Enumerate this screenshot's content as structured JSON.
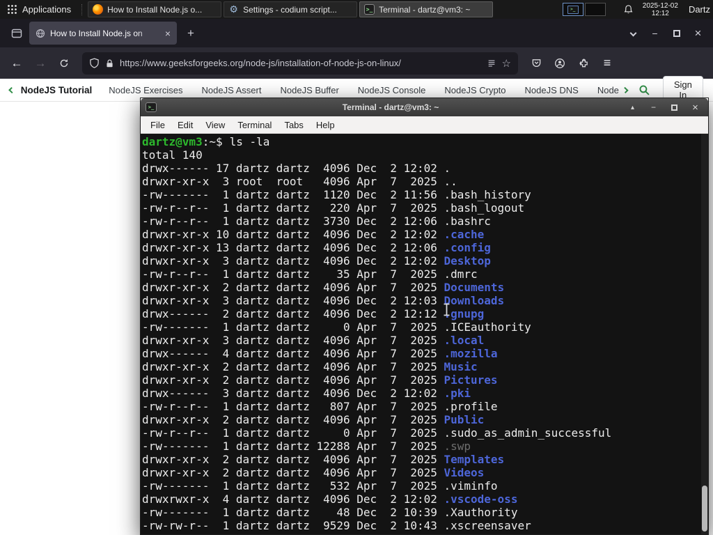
{
  "colors": {
    "gfg_green": "#2f8d46",
    "term_green": "#2db82d",
    "term_blue": "#4d66d9",
    "term_dim": "#6e6e6e"
  },
  "panel": {
    "applications": "Applications",
    "tasks": [
      {
        "label": "How to Install Node.js o...",
        "icon": "firefox"
      },
      {
        "label": "Settings - codium script...",
        "icon": "settings-gear"
      },
      {
        "label": "Terminal - dartz@vm3: ~",
        "icon": "terminal"
      }
    ],
    "date": "2025-12-02",
    "time": "12:12",
    "user": "Dartz"
  },
  "browser": {
    "active_tab": "How to Install Node.js on",
    "url": "https://www.geeksforgeeks.org/node-js/installation-of-node-js-on-linux/"
  },
  "site": {
    "primary": "NodeJS Tutorial",
    "links": [
      "NodeJS Exercises",
      "NodeJS Assert",
      "NodeJS Buffer",
      "NodeJS Console",
      "NodeJS Crypto",
      "NodeJS DNS",
      "Node"
    ],
    "sign_in": "Sign In"
  },
  "terminal": {
    "title": "Terminal - dartz@vm3: ~",
    "menus": [
      "File",
      "Edit",
      "View",
      "Terminal",
      "Tabs",
      "Help"
    ],
    "prompt_user_host": "dartz@vm3",
    "prompt_suffix": ":~$",
    "command": "ls -la",
    "total": "total 140",
    "rows": [
      {
        "perms": "drwx------",
        "links": 17,
        "owner": "dartz",
        "group": "dartz",
        "size": 4096,
        "month": "Dec",
        "day": 2,
        "when": "12:02",
        "name": ".",
        "type": "file"
      },
      {
        "perms": "drwxr-xr-x",
        "links": 3,
        "owner": "root",
        "group": "root",
        "size": 4096,
        "month": "Apr",
        "day": 7,
        "when": "2025",
        "name": "..",
        "type": "file"
      },
      {
        "perms": "-rw-------",
        "links": 1,
        "owner": "dartz",
        "group": "dartz",
        "size": 1120,
        "month": "Dec",
        "day": 2,
        "when": "11:56",
        "name": ".bash_history",
        "type": "file"
      },
      {
        "perms": "-rw-r--r--",
        "links": 1,
        "owner": "dartz",
        "group": "dartz",
        "size": 220,
        "month": "Apr",
        "day": 7,
        "when": "2025",
        "name": ".bash_logout",
        "type": "file"
      },
      {
        "perms": "-rw-r--r--",
        "links": 1,
        "owner": "dartz",
        "group": "dartz",
        "size": 3730,
        "month": "Dec",
        "day": 2,
        "when": "12:06",
        "name": ".bashrc",
        "type": "file"
      },
      {
        "perms": "drwxr-xr-x",
        "links": 10,
        "owner": "dartz",
        "group": "dartz",
        "size": 4096,
        "month": "Dec",
        "day": 2,
        "when": "12:02",
        "name": ".cache",
        "type": "dir"
      },
      {
        "perms": "drwxr-xr-x",
        "links": 13,
        "owner": "dartz",
        "group": "dartz",
        "size": 4096,
        "month": "Dec",
        "day": 2,
        "when": "12:06",
        "name": ".config",
        "type": "dir"
      },
      {
        "perms": "drwxr-xr-x",
        "links": 3,
        "owner": "dartz",
        "group": "dartz",
        "size": 4096,
        "month": "Dec",
        "day": 2,
        "when": "12:02",
        "name": "Desktop",
        "type": "dir"
      },
      {
        "perms": "-rw-r--r--",
        "links": 1,
        "owner": "dartz",
        "group": "dartz",
        "size": 35,
        "month": "Apr",
        "day": 7,
        "when": "2025",
        "name": ".dmrc",
        "type": "file"
      },
      {
        "perms": "drwxr-xr-x",
        "links": 2,
        "owner": "dartz",
        "group": "dartz",
        "size": 4096,
        "month": "Apr",
        "day": 7,
        "when": "2025",
        "name": "Documents",
        "type": "dir"
      },
      {
        "perms": "drwxr-xr-x",
        "links": 3,
        "owner": "dartz",
        "group": "dartz",
        "size": 4096,
        "month": "Dec",
        "day": 2,
        "when": "12:03",
        "name": "Downloads",
        "type": "dir"
      },
      {
        "perms": "drwx------",
        "links": 2,
        "owner": "dartz",
        "group": "dartz",
        "size": 4096,
        "month": "Dec",
        "day": 2,
        "when": "12:12",
        "name": ".gnupg",
        "type": "dir"
      },
      {
        "perms": "-rw-------",
        "links": 1,
        "owner": "dartz",
        "group": "dartz",
        "size": 0,
        "month": "Apr",
        "day": 7,
        "when": "2025",
        "name": ".ICEauthority",
        "type": "file"
      },
      {
        "perms": "drwxr-xr-x",
        "links": 3,
        "owner": "dartz",
        "group": "dartz",
        "size": 4096,
        "month": "Apr",
        "day": 7,
        "when": "2025",
        "name": ".local",
        "type": "dir"
      },
      {
        "perms": "drwx------",
        "links": 4,
        "owner": "dartz",
        "group": "dartz",
        "size": 4096,
        "month": "Apr",
        "day": 7,
        "when": "2025",
        "name": ".mozilla",
        "type": "dir"
      },
      {
        "perms": "drwxr-xr-x",
        "links": 2,
        "owner": "dartz",
        "group": "dartz",
        "size": 4096,
        "month": "Apr",
        "day": 7,
        "when": "2025",
        "name": "Music",
        "type": "dir"
      },
      {
        "perms": "drwxr-xr-x",
        "links": 2,
        "owner": "dartz",
        "group": "dartz",
        "size": 4096,
        "month": "Apr",
        "day": 7,
        "when": "2025",
        "name": "Pictures",
        "type": "dir"
      },
      {
        "perms": "drwx------",
        "links": 3,
        "owner": "dartz",
        "group": "dartz",
        "size": 4096,
        "month": "Dec",
        "day": 2,
        "when": "12:02",
        "name": ".pki",
        "type": "dir"
      },
      {
        "perms": "-rw-r--r--",
        "links": 1,
        "owner": "dartz",
        "group": "dartz",
        "size": 807,
        "month": "Apr",
        "day": 7,
        "when": "2025",
        "name": ".profile",
        "type": "file"
      },
      {
        "perms": "drwxr-xr-x",
        "links": 2,
        "owner": "dartz",
        "group": "dartz",
        "size": 4096,
        "month": "Apr",
        "day": 7,
        "when": "2025",
        "name": "Public",
        "type": "dir"
      },
      {
        "perms": "-rw-r--r--",
        "links": 1,
        "owner": "dartz",
        "group": "dartz",
        "size": 0,
        "month": "Apr",
        "day": 7,
        "when": "2025",
        "name": ".sudo_as_admin_successful",
        "type": "file"
      },
      {
        "perms": "-rw-------",
        "links": 1,
        "owner": "dartz",
        "group": "dartz",
        "size": 12288,
        "month": "Apr",
        "day": 7,
        "when": "2025",
        "name": ".swp",
        "type": "dim"
      },
      {
        "perms": "drwxr-xr-x",
        "links": 2,
        "owner": "dartz",
        "group": "dartz",
        "size": 4096,
        "month": "Apr",
        "day": 7,
        "when": "2025",
        "name": "Templates",
        "type": "dir"
      },
      {
        "perms": "drwxr-xr-x",
        "links": 2,
        "owner": "dartz",
        "group": "dartz",
        "size": 4096,
        "month": "Apr",
        "day": 7,
        "when": "2025",
        "name": "Videos",
        "type": "dir"
      },
      {
        "perms": "-rw-------",
        "links": 1,
        "owner": "dartz",
        "group": "dartz",
        "size": 532,
        "month": "Apr",
        "day": 7,
        "when": "2025",
        "name": ".viminfo",
        "type": "file"
      },
      {
        "perms": "drwxrwxr-x",
        "links": 4,
        "owner": "dartz",
        "group": "dartz",
        "size": 4096,
        "month": "Dec",
        "day": 2,
        "when": "12:02",
        "name": ".vscode-oss",
        "type": "dir"
      },
      {
        "perms": "-rw-------",
        "links": 1,
        "owner": "dartz",
        "group": "dartz",
        "size": 48,
        "month": "Dec",
        "day": 2,
        "when": "10:39",
        "name": ".Xauthority",
        "type": "file"
      },
      {
        "perms": "-rw-rw-r--",
        "links": 1,
        "owner": "dartz",
        "group": "dartz",
        "size": 9529,
        "month": "Dec",
        "day": 2,
        "when": "10:43",
        "name": ".xscreensaver",
        "type": "file"
      }
    ]
  }
}
